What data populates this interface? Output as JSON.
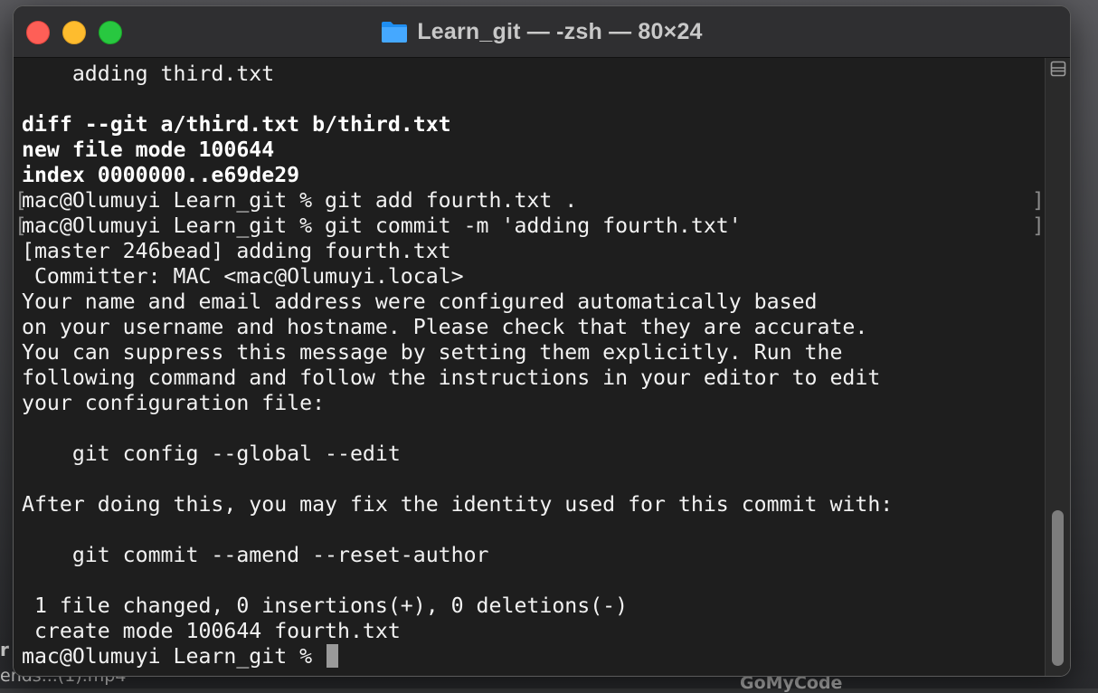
{
  "window": {
    "title": "Learn_git — -zsh — 80×24",
    "folder_icon": "folder-icon"
  },
  "desktop": {
    "fragment_left_1": "r",
    "fragment_left_2": "ends...(1).mp4",
    "fragment_right": "GoMyCode"
  },
  "terminal": {
    "lines": [
      {
        "text": "    adding third.txt",
        "bold": false
      },
      {
        "text": "",
        "bold": false
      },
      {
        "text": "diff --git a/third.txt b/third.txt",
        "bold": true
      },
      {
        "text": "new file mode 100644",
        "bold": true
      },
      {
        "text": "index 0000000..e69de29",
        "bold": true
      },
      {
        "text": "mac@Olumuyi Learn_git % git add fourth.txt .",
        "bold": false,
        "bracketed": true
      },
      {
        "text": "mac@Olumuyi Learn_git % git commit -m 'adding fourth.txt'",
        "bold": false,
        "bracketed": true
      },
      {
        "text": "[master 246bead] adding fourth.txt",
        "bold": false
      },
      {
        "text": " Committer: MAC <mac@Olumuyi.local>",
        "bold": false
      },
      {
        "text": "Your name and email address were configured automatically based",
        "bold": false
      },
      {
        "text": "on your username and hostname. Please check that they are accurate.",
        "bold": false
      },
      {
        "text": "You can suppress this message by setting them explicitly. Run the",
        "bold": false
      },
      {
        "text": "following command and follow the instructions in your editor to edit",
        "bold": false
      },
      {
        "text": "your configuration file:",
        "bold": false
      },
      {
        "text": "",
        "bold": false
      },
      {
        "text": "    git config --global --edit",
        "bold": false
      },
      {
        "text": "",
        "bold": false
      },
      {
        "text": "After doing this, you may fix the identity used for this commit with:",
        "bold": false
      },
      {
        "text": "",
        "bold": false
      },
      {
        "text": "    git commit --amend --reset-author",
        "bold": false
      },
      {
        "text": "",
        "bold": false
      },
      {
        "text": " 1 file changed, 0 insertions(+), 0 deletions(-)",
        "bold": false
      },
      {
        "text": " create mode 100644 fourth.txt",
        "bold": false
      },
      {
        "text": "mac@Olumuyi Learn_git % ",
        "bold": false,
        "prompt": true
      }
    ],
    "bracket_left": "[",
    "bracket_right": "]"
  },
  "colors": {
    "close": "#fe5f57",
    "minimize": "#febc2e",
    "maximize": "#28c840",
    "terminal_bg": "#1e1e1e",
    "text": "#f2f2f2"
  }
}
